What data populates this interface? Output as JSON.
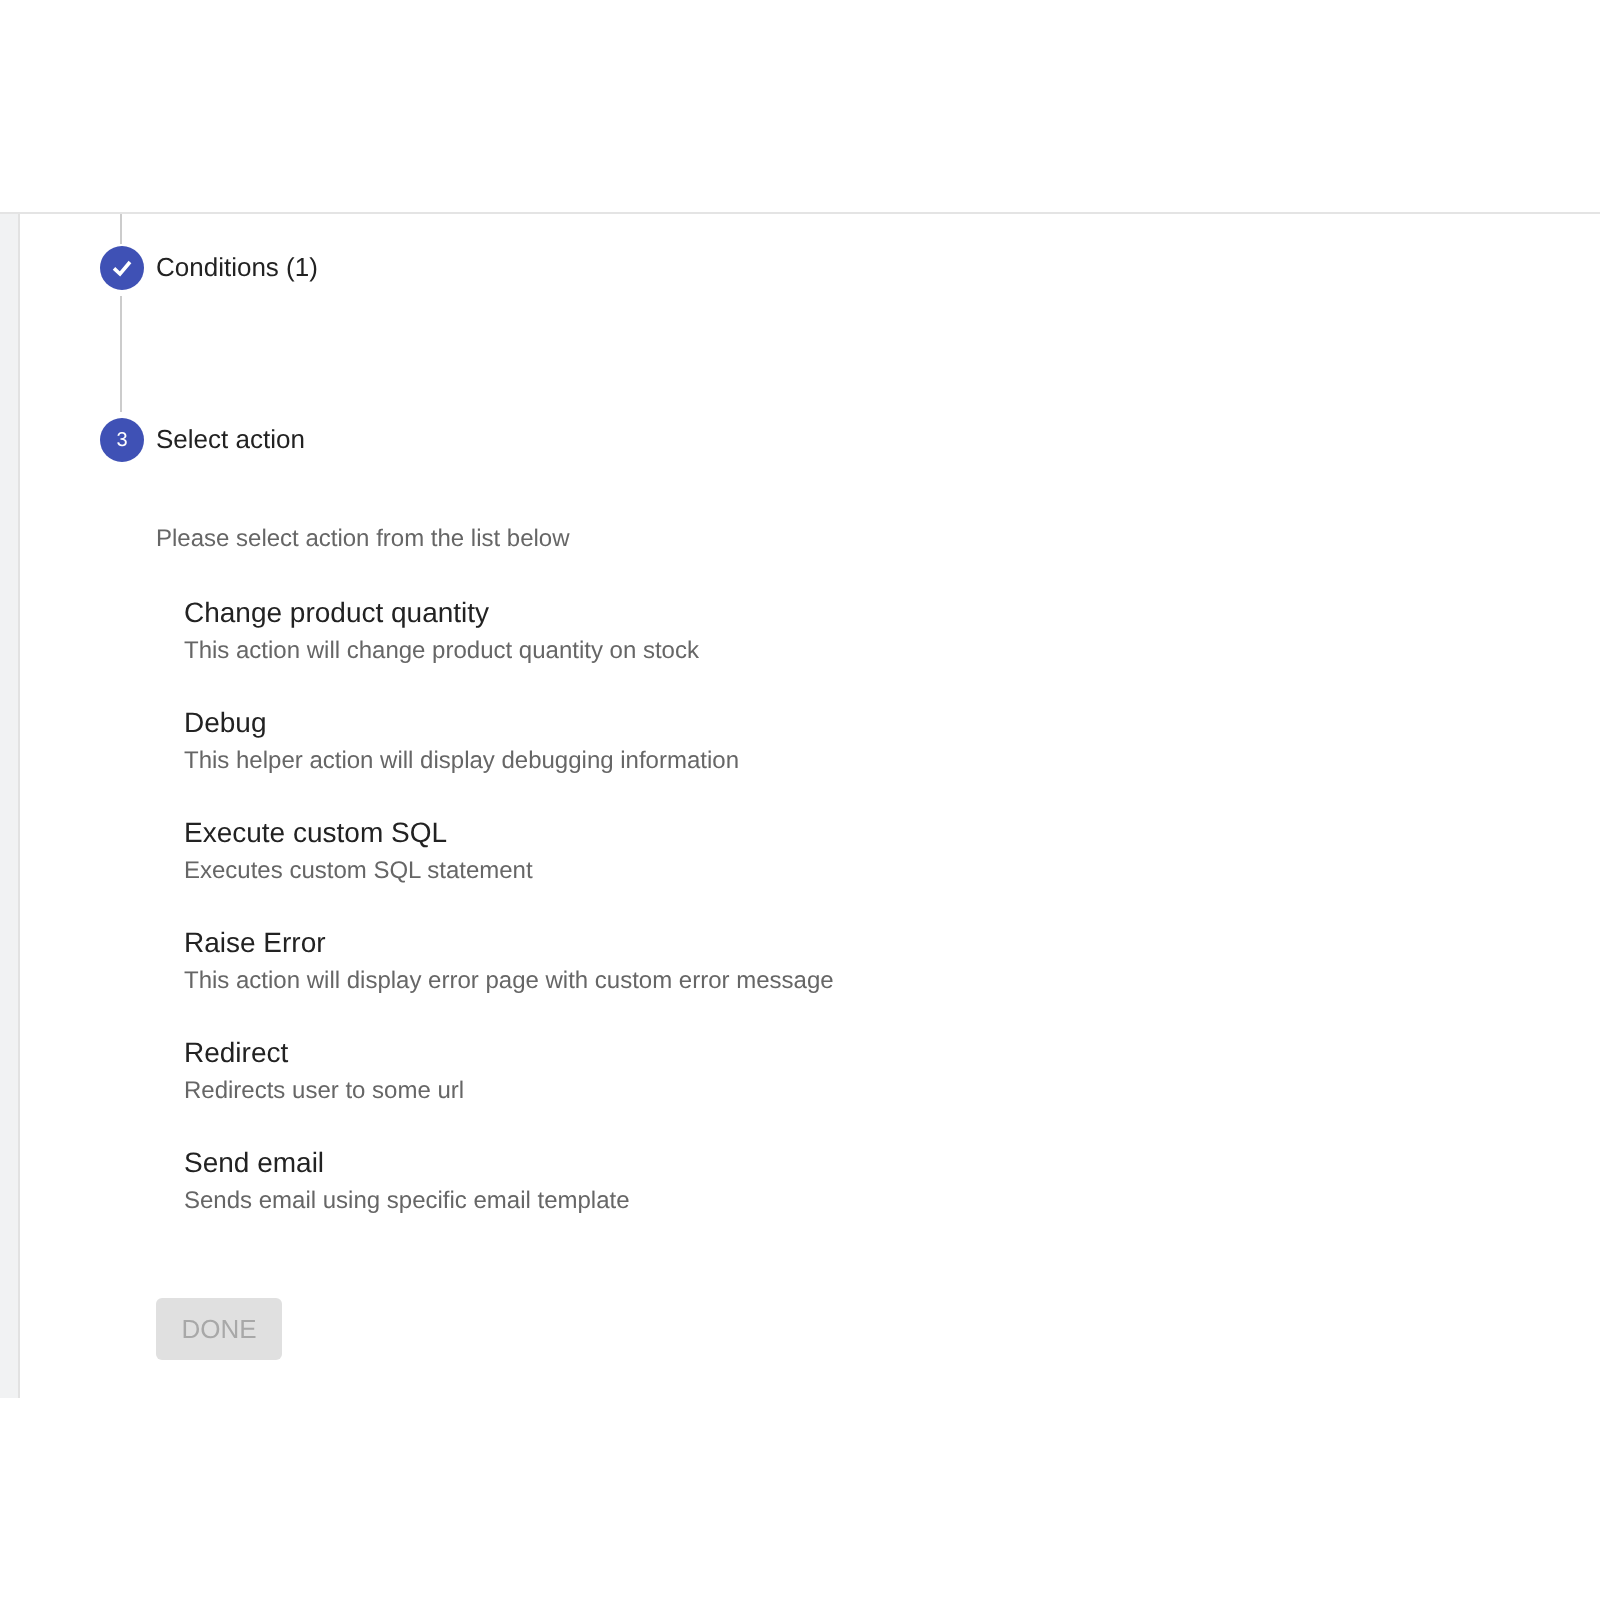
{
  "steps": [
    {
      "kind": "done",
      "label": "Conditions (1)"
    },
    {
      "kind": "active",
      "number": "3",
      "label": "Select action"
    }
  ],
  "instruction": "Please select action from the list below",
  "actions": [
    {
      "title": "Change product quantity",
      "description": "This action will change product quantity on stock"
    },
    {
      "title": "Debug",
      "description": "This helper action will display debugging information"
    },
    {
      "title": "Execute custom SQL",
      "description": "Executes custom SQL statement"
    },
    {
      "title": "Raise Error",
      "description": "This action will display error page with custom error message"
    },
    {
      "title": "Redirect",
      "description": "Redirects user to some url"
    },
    {
      "title": "Send email",
      "description": "Sends email using specific email template"
    }
  ],
  "done_button": {
    "label": "DONE",
    "disabled": true
  }
}
